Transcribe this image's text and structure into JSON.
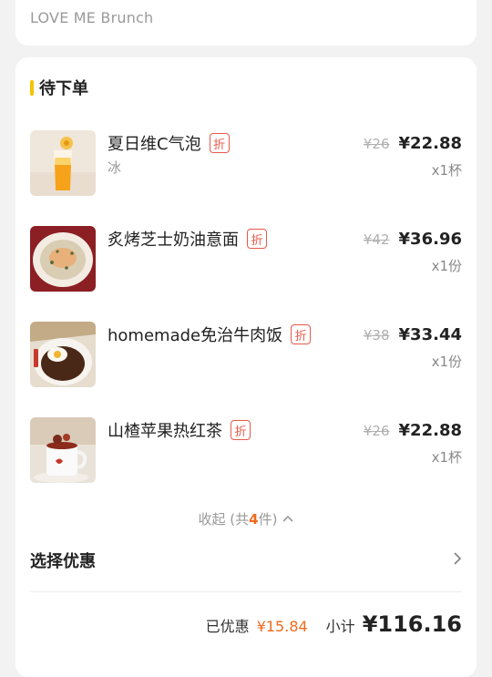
{
  "store": {
    "name": "LOVE ME Brunch"
  },
  "section": {
    "title": "待下单"
  },
  "items": [
    {
      "name": "夏日维C气泡",
      "tag": "折",
      "spec": "冰",
      "orig_price": "¥26",
      "price": "¥22.88",
      "qty": "x1杯",
      "thumb_icon": "orange-soda-image"
    },
    {
      "name": "炙烤芝士奶油意面",
      "tag": "折",
      "spec": "",
      "orig_price": "¥42",
      "price": "¥36.96",
      "qty": "x1份",
      "thumb_icon": "pasta-image"
    },
    {
      "name": "homemade免治牛肉饭",
      "tag": "折",
      "spec": "",
      "orig_price": "¥38",
      "price": "¥33.44",
      "qty": "x1份",
      "thumb_icon": "beef-rice-image"
    },
    {
      "name": "山楂苹果热红茶",
      "tag": "折",
      "spec": "",
      "orig_price": "¥26",
      "price": "¥22.88",
      "qty": "x1杯",
      "thumb_icon": "tea-image"
    }
  ],
  "collapse": {
    "prefix": "收起 (共",
    "count": "4",
    "suffix": "件)",
    "icon": "chevron-up-icon"
  },
  "promo": {
    "label": "选择优惠",
    "icon": "chevron-right-icon"
  },
  "summary": {
    "discount_label": "已优惠",
    "discount_value": "¥15.84",
    "subtotal_label": "小计",
    "subtotal_value": "¥116.16"
  },
  "colors": {
    "accent": "#f06a1e",
    "tag": "#e8584a",
    "title_bar": "#f5c400"
  }
}
